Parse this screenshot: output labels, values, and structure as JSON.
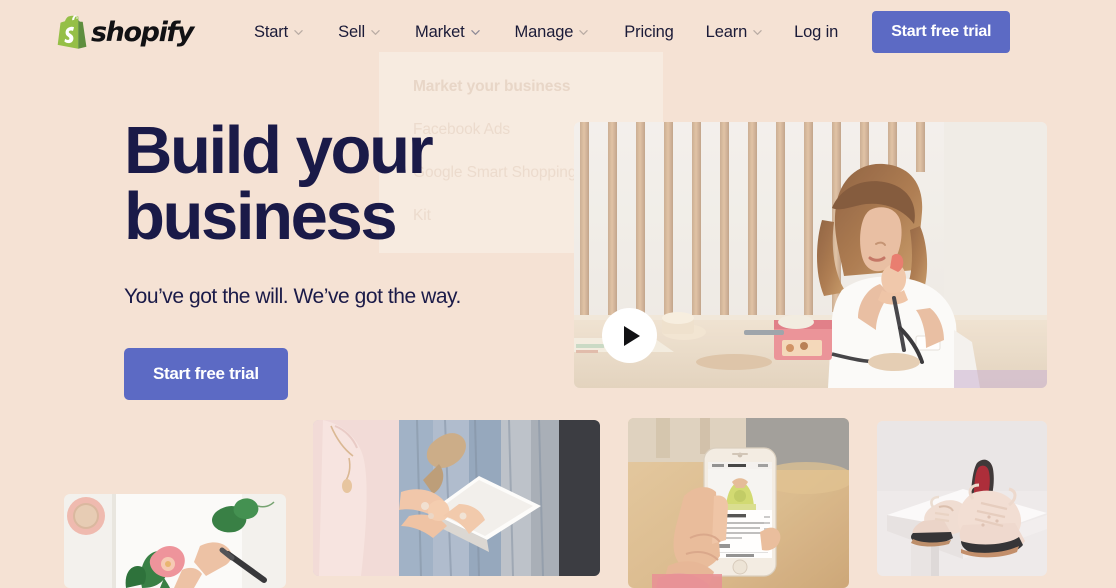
{
  "page": {
    "background_color": "#f5e2d4",
    "text_color": "#1a1a48",
    "accent_color": "#5c6ac4",
    "logo_green": "#95bf47"
  },
  "header": {
    "logo": {
      "icon": "shopify-bag-icon",
      "wordmark": "shopify"
    },
    "nav_items": [
      {
        "label": "Start",
        "has_chevron": true
      },
      {
        "label": "Sell",
        "has_chevron": true
      },
      {
        "label": "Market",
        "has_chevron": true
      },
      {
        "label": "Manage",
        "has_chevron": true
      }
    ],
    "nav_right": [
      {
        "label": "Pricing",
        "has_chevron": false
      },
      {
        "label": "Learn",
        "has_chevron": true
      },
      {
        "label": "Log in",
        "has_chevron": false
      }
    ],
    "cta_label": "Start free trial"
  },
  "dropdown": {
    "heading": "Market your business",
    "links": [
      "Facebook Ads",
      "Google Smart Shopping",
      "Kit"
    ]
  },
  "hero": {
    "title_line_1": "Build your",
    "title_line_2": "business",
    "subtitle": "You’ve got the will. We’ve got the way.",
    "cta_label": "Start free trial"
  },
  "media": {
    "video": {
      "alt": "Woman crafting jewelry at a workbench in front of wooden slat wall",
      "play_icon": "play-triangle-icon"
    },
    "cards": [
      {
        "name": "notebook",
        "alt": "Hand sketching a pink camellia flower in a notebook beside a pink mug"
      },
      {
        "name": "tablet",
        "alt": "Hands holding a white tablet in front of a rack of denim clothing"
      },
      {
        "name": "phone",
        "alt": "Hand holding an iPhone displaying an online store product page"
      },
      {
        "name": "shoes",
        "alt": "Pair of blush pink brogue shoes on a white pedestal"
      }
    ]
  }
}
